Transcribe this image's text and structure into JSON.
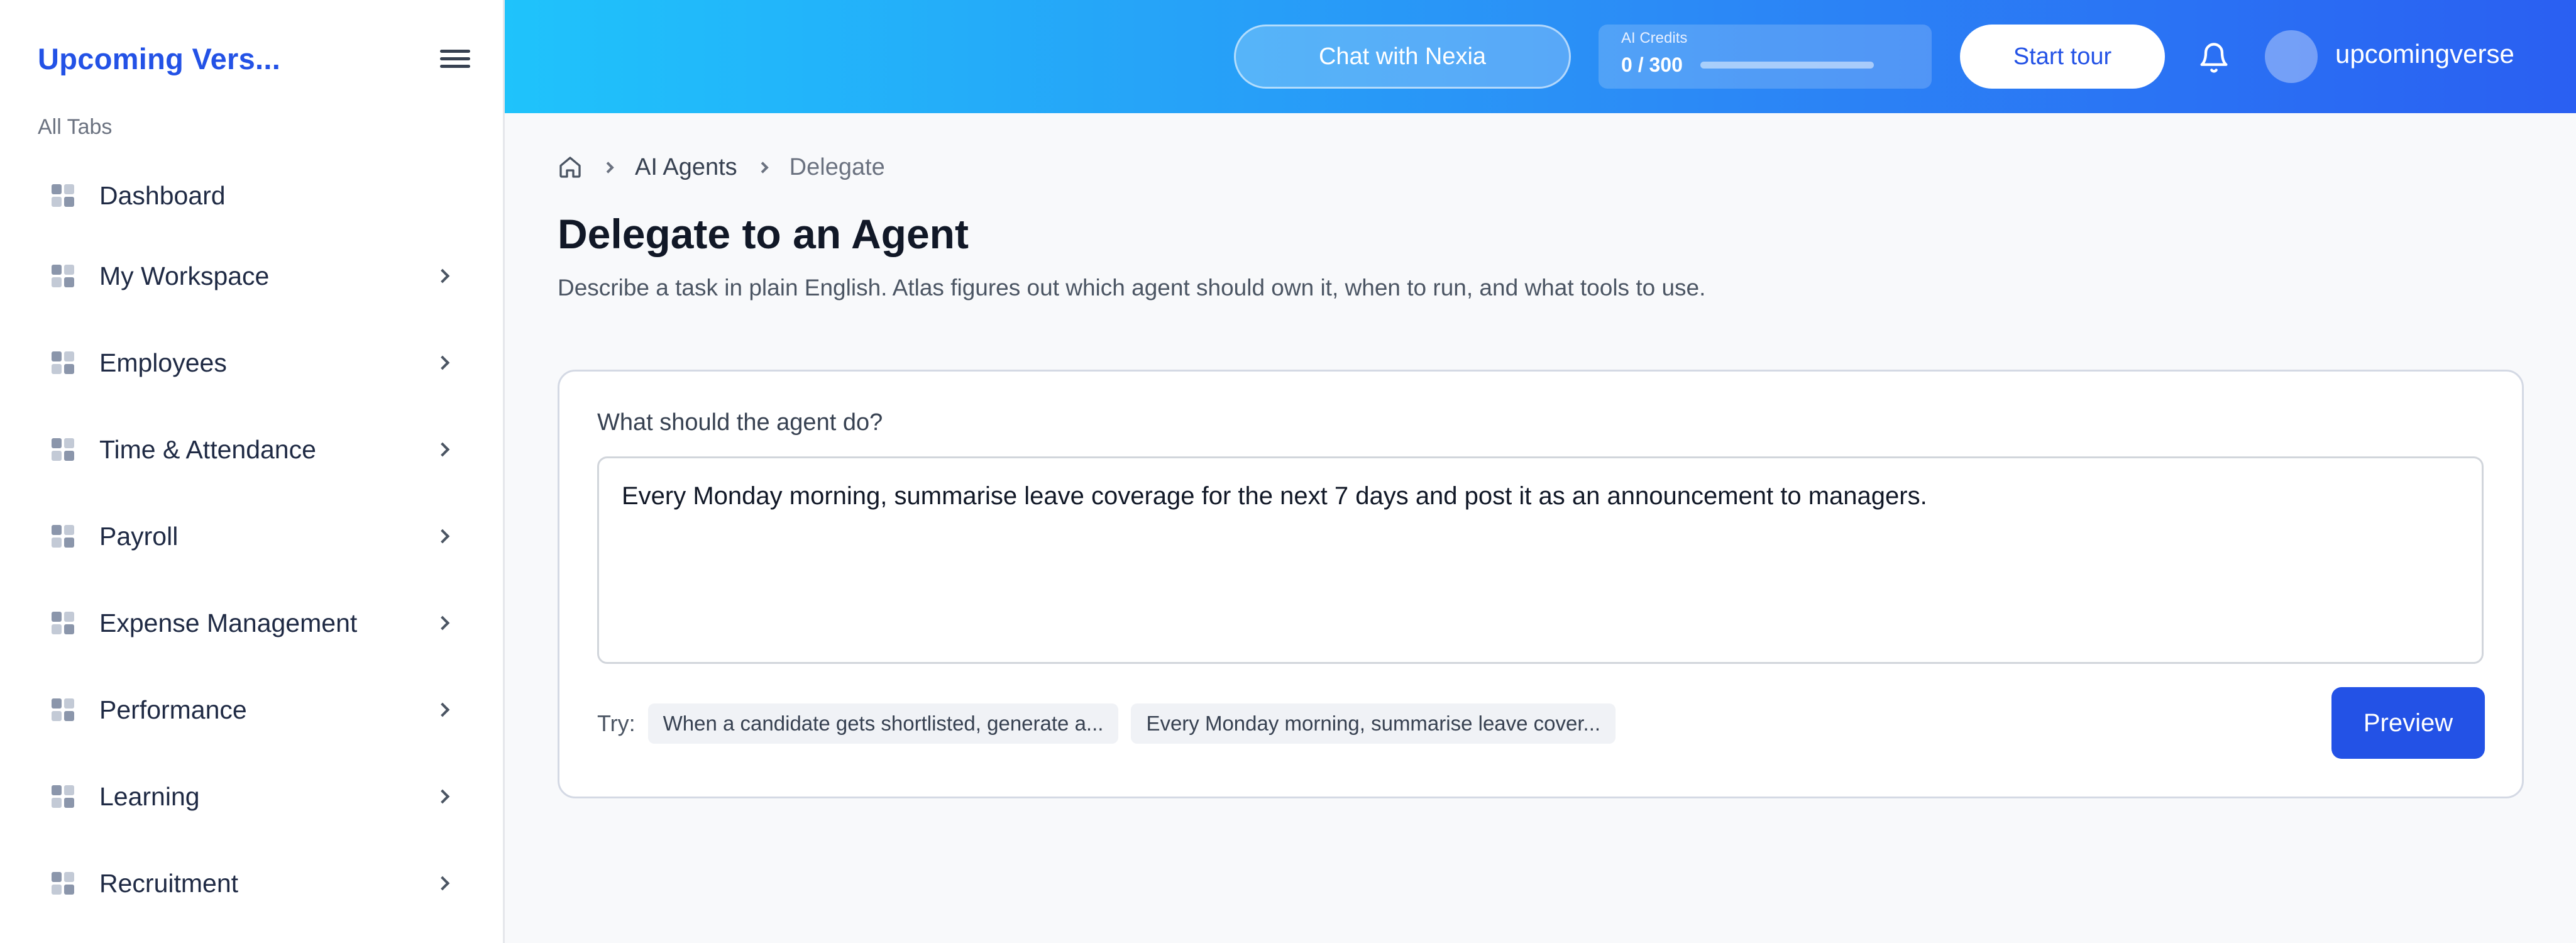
{
  "sidebar": {
    "brand": "Upcoming Vers...",
    "section_label": "All Tabs",
    "items": [
      {
        "label": "Dashboard",
        "has_chevron": false
      },
      {
        "label": "My Workspace",
        "has_chevron": true
      },
      {
        "label": "Employees",
        "has_chevron": true
      },
      {
        "label": "Time & Attendance",
        "has_chevron": true
      },
      {
        "label": "Payroll",
        "has_chevron": true
      },
      {
        "label": "Expense Management",
        "has_chevron": true
      },
      {
        "label": "Performance",
        "has_chevron": true
      },
      {
        "label": "Learning",
        "has_chevron": true
      },
      {
        "label": "Recruitment",
        "has_chevron": true
      }
    ]
  },
  "topbar": {
    "chat_label": "Chat with Nexia",
    "credits_label": "AI Credits",
    "credits_value": "0 / 300",
    "credits_used": 0,
    "credits_total": 300,
    "tour_label": "Start tour",
    "username": "upcomingverse"
  },
  "breadcrumb": {
    "items": [
      "AI Agents",
      "Delegate"
    ]
  },
  "page": {
    "title": "Delegate to an Agent",
    "description": "Describe a task in plain English. Atlas figures out which agent should own it, when to run, and what tools to use."
  },
  "form": {
    "field_label": "What should the agent do?",
    "task_value": "Every Monday morning, summarise leave coverage for the next 7 days and post it as an announcement to managers.",
    "try_label": "Try:",
    "suggestions": [
      "When a candidate gets shortlisted, generate a...",
      "Every Monday morning, summarise leave cover..."
    ],
    "preview_label": "Preview"
  },
  "colors": {
    "accent": "#2352e6",
    "topbar_start": "#1fc3fb",
    "topbar_end": "#2a5ff2"
  }
}
